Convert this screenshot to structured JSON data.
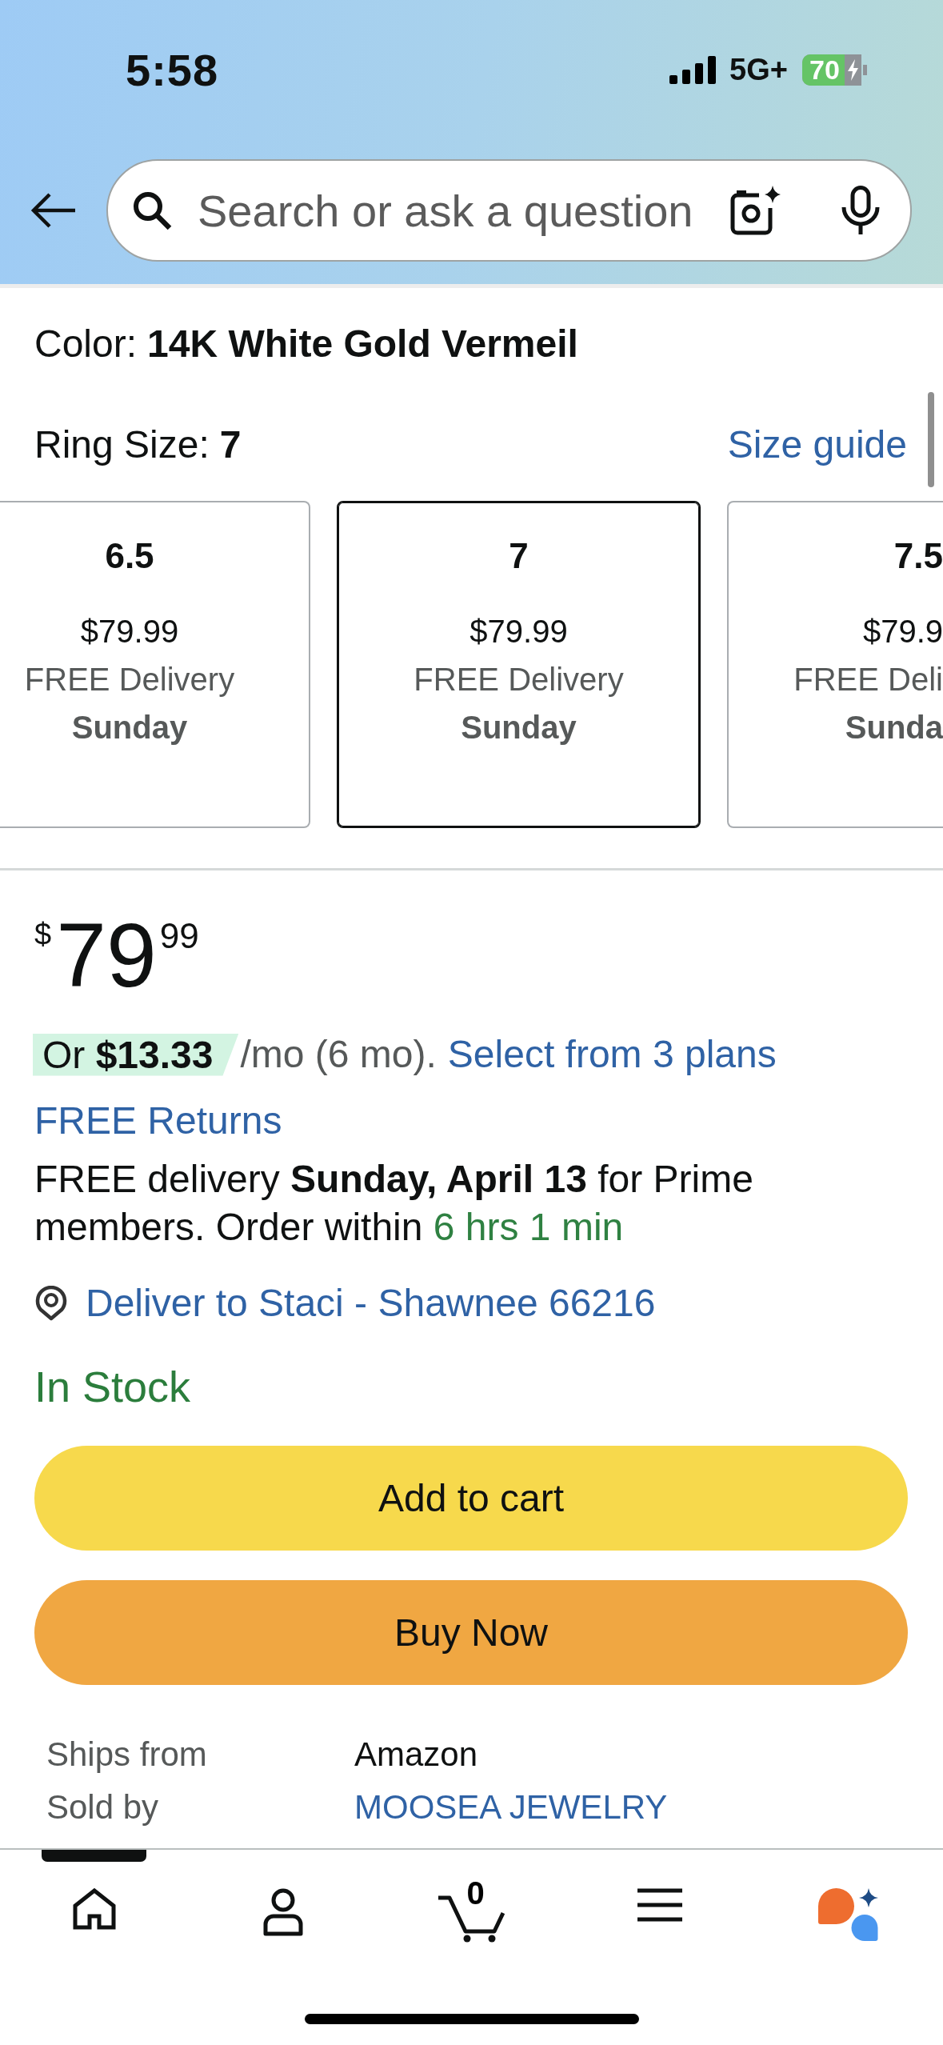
{
  "status_bar": {
    "time": "5:58",
    "network": "5G+",
    "battery": "70",
    "charging": true
  },
  "search": {
    "placeholder": "Search or ask a question"
  },
  "product": {
    "color_option": {
      "label": "Color:",
      "value": "14K White Gold Vermeil"
    },
    "ring_size": {
      "label": "Ring Size:",
      "value": "7"
    },
    "size_guide": "Size guide",
    "sizes": [
      {
        "size": "6.5",
        "price": "$79.99",
        "delivery": "FREE Delivery",
        "day": "Sunday",
        "selected": false
      },
      {
        "size": "7",
        "price": "$79.99",
        "delivery": "FREE Delivery",
        "day": "Sunday",
        "selected": true
      },
      {
        "size": "7.5",
        "price": "$79.9",
        "delivery": "FREE Deli",
        "day": "Sunda",
        "selected": false
      }
    ]
  },
  "price": {
    "currency": "$",
    "whole": "79",
    "fraction": "99"
  },
  "installments": {
    "offer": "Or **$13.33**",
    "terms": "/mo (6 mo).",
    "link": "Select from 3 plans"
  },
  "returns": "FREE Returns",
  "delivery": {
    "message": "FREE delivery **Sunday, April 13** for Prime members. Order within",
    "countdown": "6 hrs 1 min"
  },
  "location": "Deliver to Staci - Shawnee 66216",
  "availability": "In Stock",
  "buttons": [
    {
      "kind": "add_to_cart",
      "label": "Add to cart"
    },
    {
      "kind": "buy_now",
      "label": "Buy Now"
    }
  ],
  "details": [
    {
      "kind": "text",
      "label": "Ships from",
      "value": "Amazon"
    },
    {
      "kind": "link",
      "label": "Sold by",
      "value": "MOOSEA JEWELRY"
    }
  ],
  "nav": {
    "items": [
      {
        "kind": "home",
        "selected": true
      },
      {
        "kind": "account",
        "selected": false
      },
      {
        "kind": "cart",
        "count": "0",
        "selected": false
      },
      {
        "kind": "menu",
        "selected": false
      },
      {
        "kind": "assistant",
        "selected": false
      }
    ]
  }
}
